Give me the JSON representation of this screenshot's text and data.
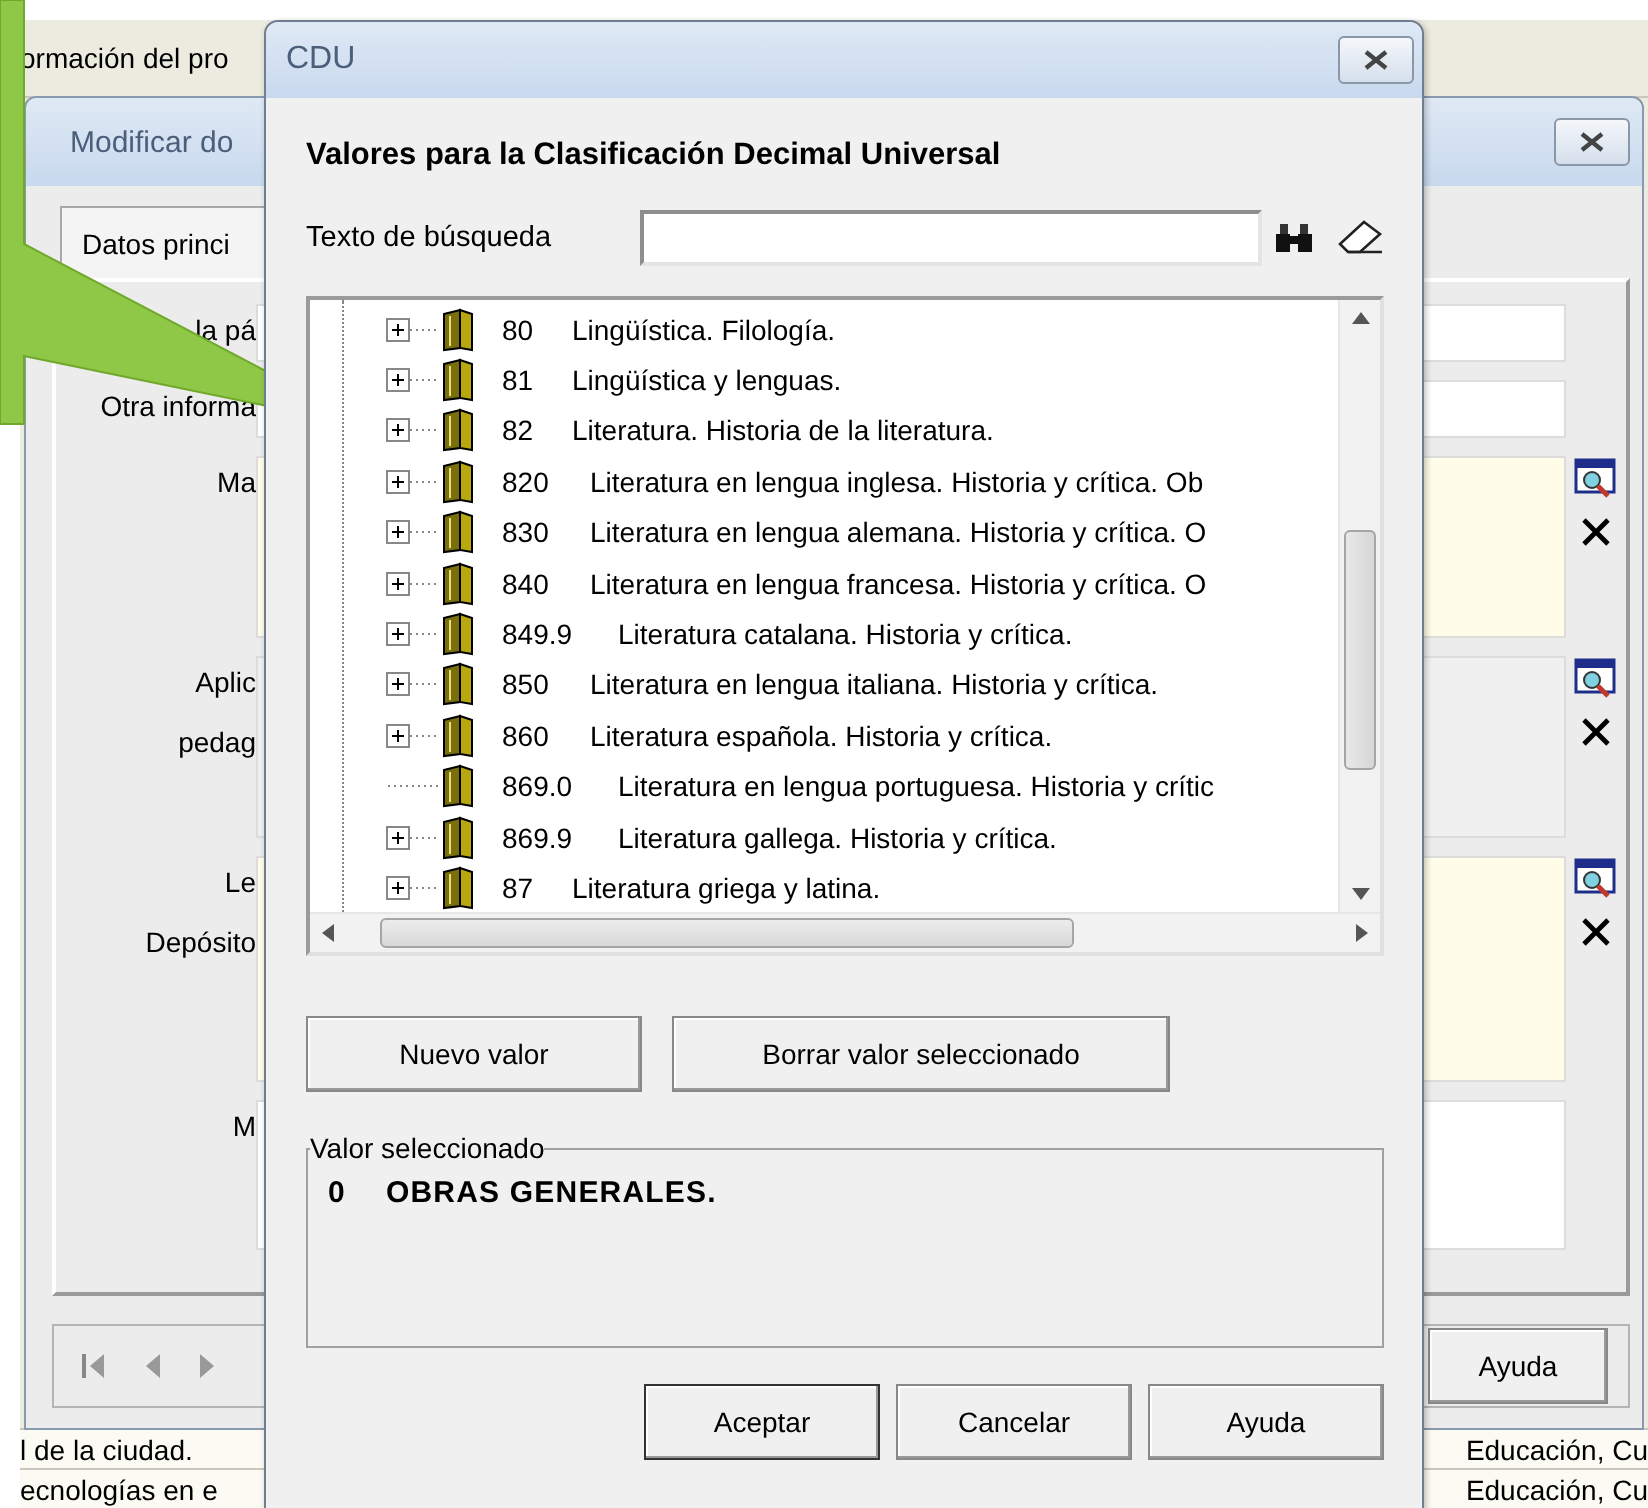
{
  "background_app": {
    "header": "ormación del pro",
    "window": {
      "title": "Modificar do",
      "tab": "Datos princi",
      "fields": [
        {
          "kind": "text",
          "labels": [
            "la pá"
          ]
        },
        {
          "kind": "text",
          "labels": [
            "Otra informa"
          ]
        },
        {
          "kind": "lookup",
          "labels": [
            "Ma"
          ]
        },
        {
          "kind": "scroll-lookup",
          "labels": [
            "Aplic",
            "pedag"
          ]
        },
        {
          "kind": "lookup",
          "labels": [
            "Le",
            "Depósito"
          ]
        },
        {
          "kind": "memo",
          "labels": [
            "M"
          ]
        }
      ],
      "help_button": "Ayuda"
    },
    "rows": [
      {
        "left": "l de la ciudad.",
        "right": "Educación, Cu"
      },
      {
        "left": "ecnologías en e",
        "right": "Educación, Cu"
      }
    ]
  },
  "dialog": {
    "title": "CDU",
    "heading": "Valores para la Clasificación Decimal Universal",
    "search": {
      "label": "Texto de búsqueda"
    },
    "tree": [
      {
        "code": "80",
        "title": "Lingüística. Filología.",
        "expandable": true
      },
      {
        "code": "81",
        "title": "Lingüística y lenguas.",
        "expandable": true
      },
      {
        "code": "82",
        "title": "Literatura. Historia de la literatura.",
        "expandable": true
      },
      {
        "code": "820",
        "title": "Literatura en lengua inglesa. Historia y crítica. Ob",
        "expandable": true
      },
      {
        "code": "830",
        "title": "Literatura en lengua alemana. Historia y crítica. O",
        "expandable": true
      },
      {
        "code": "840",
        "title": "Literatura en lengua francesa. Historia y crítica. O",
        "expandable": true
      },
      {
        "code": "849.9",
        "title": "Literatura catalana. Historia y crítica.",
        "expandable": true
      },
      {
        "code": "850",
        "title": "Literatura en lengua italiana. Historia y crítica.",
        "expandable": true
      },
      {
        "code": "860",
        "title": "Literatura española. Historia y crítica.",
        "expandable": true
      },
      {
        "code": "869.0",
        "title": "Literatura en lengua portuguesa. Historia y crític",
        "expandable": false
      },
      {
        "code": "869.9",
        "title": "Literatura gallega. Historia y crítica.",
        "expandable": true
      },
      {
        "code": "87",
        "title": "Literatura griega y latina.",
        "expandable": true
      }
    ],
    "action_buttons": [
      "Nuevo valor",
      "Borrar valor seleccionado"
    ],
    "selected_group": {
      "title": "Valor seleccionado",
      "code": "0",
      "value": "OBRAS GENERALES."
    },
    "footer_buttons": [
      {
        "label": "Aceptar",
        "default": true
      },
      {
        "label": "Cancelar",
        "default": false
      },
      {
        "label": "Ayuda",
        "default": false
      }
    ]
  }
}
